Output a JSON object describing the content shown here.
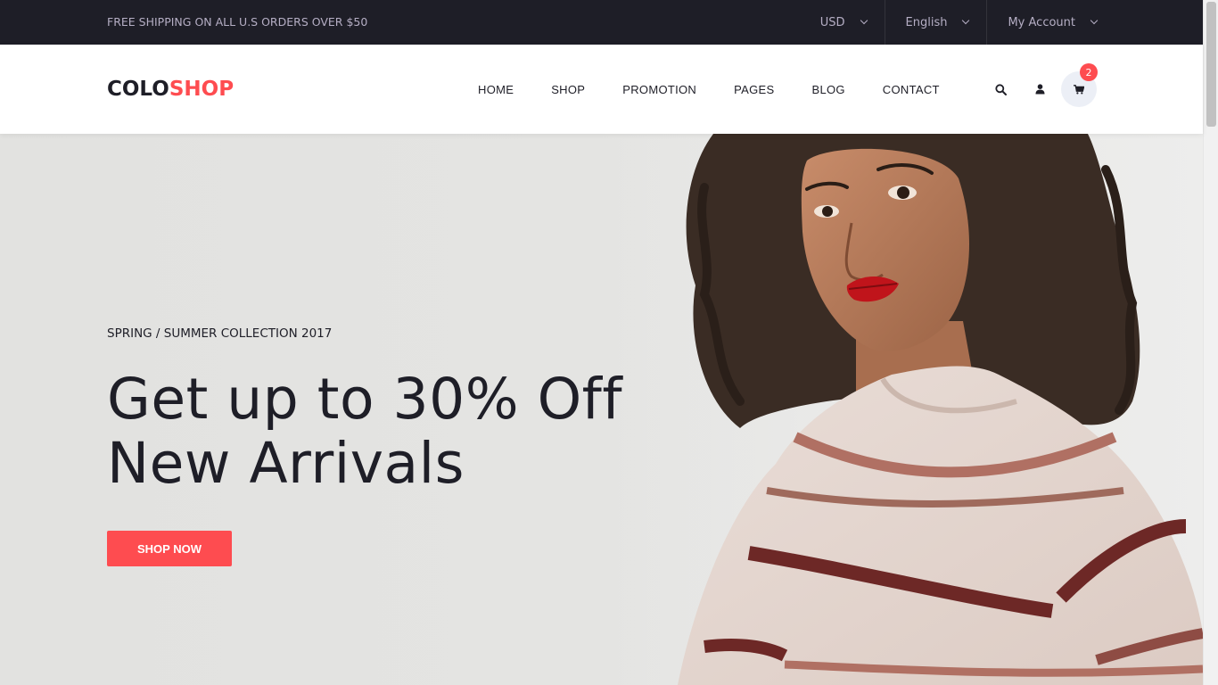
{
  "top_bar": {
    "promo_text": "FREE SHIPPING ON ALL U.S ORDERS OVER $50",
    "currency": "USD",
    "language": "English",
    "account": "My Account"
  },
  "header": {
    "logo_part1": "COLO",
    "logo_part2": "SHOP",
    "nav": [
      "HOME",
      "SHOP",
      "PROMOTION",
      "PAGES",
      "BLOG",
      "CONTACT"
    ],
    "icons": [
      "search-icon",
      "user-icon",
      "cart-icon"
    ],
    "cart_count": "2"
  },
  "hero": {
    "collection": "SPRING / SUMMER COLLECTION 2017",
    "headline_line1": "Get up to 30% Off",
    "headline_line2": "New Arrivals",
    "cta": "SHOP NOW"
  },
  "colors": {
    "accent": "#fe4c50",
    "dark": "#1e1e27",
    "top_bar_text": "#b5aec4"
  }
}
